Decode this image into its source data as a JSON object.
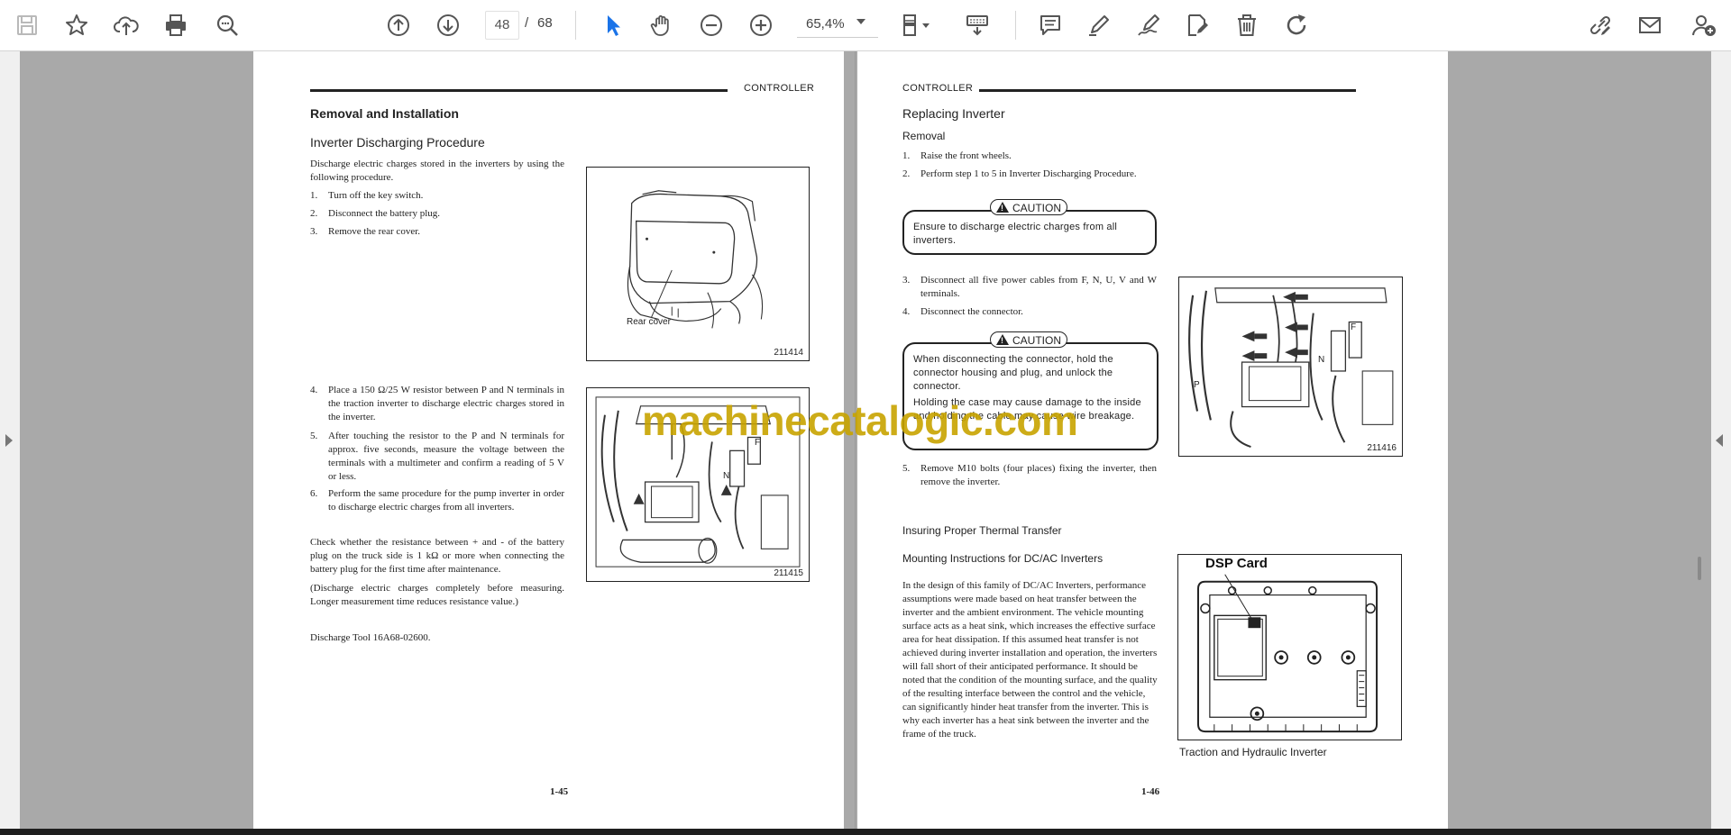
{
  "toolbar": {
    "page_current": "48",
    "page_separator": "/",
    "page_total": "68",
    "zoom_value": "65,4%",
    "icons": [
      "save-icon",
      "bookmark-star-icon",
      "upload-cloud-icon",
      "print-icon",
      "search-zoom-icon",
      "arrow-up-circle-icon",
      "arrow-down-circle-icon",
      "select-cursor-icon",
      "hand-tool-icon",
      "zoom-out-icon",
      "zoom-in-icon",
      "page-display-icon",
      "keyboard-scroll-icon",
      "comment-icon",
      "highlight-pen-icon",
      "draw-pen-icon",
      "edit-pdf-icon",
      "trash-icon",
      "rotate-icon",
      "share-link-icon",
      "email-icon",
      "add-user-icon"
    ]
  },
  "left_page": {
    "header": "CONTROLLER",
    "section_title": "Removal and Installation",
    "subsection_title": "Inverter Discharging Procedure",
    "intro": "Discharge electric charges stored in the inverters by using the following procedure.",
    "steps_a": [
      {
        "n": "1.",
        "text": "Turn off the key switch."
      },
      {
        "n": "2.",
        "text": "Disconnect the battery plug."
      },
      {
        "n": "3.",
        "text": "Remove the rear cover."
      }
    ],
    "fig1": {
      "label": "Rear cover",
      "number": "211414"
    },
    "steps_b": [
      {
        "n": "4.",
        "text": "Place a 150 Ω/25 W resistor between P and N terminals in the traction inverter to discharge electric charges stored in the inverter."
      },
      {
        "n": "5.",
        "text": "After touching the resistor to the P and N terminals for approx. five seconds, measure the voltage between the terminals with a multimeter and confirm a reading of 5 V or less."
      },
      {
        "n": "6.",
        "text": "Perform the same procedure for the pump inverter in order to discharge electric charges from all inverters."
      }
    ],
    "fig2": {
      "number": "211415",
      "label_f": "F",
      "label_n": "N"
    },
    "note1": "Check whether the resistance between + and - of the battery plug on the truck side is 1 kΩ or more when connecting the battery plug for the first time after maintenance.",
    "note2": "(Discharge electric charges completely before measuring. Longer measurement time reduces resistance value.)",
    "tool": "Discharge Tool 16A68-02600.",
    "page_number": "1-45"
  },
  "right_page": {
    "header": "CONTROLLER",
    "section_title": "Replacing Inverter",
    "subsection_title": "Removal",
    "steps_a": [
      {
        "n": "1.",
        "text": "Raise the front wheels."
      },
      {
        "n": "2.",
        "text": "Perform step 1 to 5 in Inverter Discharging Procedure."
      }
    ],
    "caution1": {
      "badge": "CAUTION",
      "text": "Ensure to discharge electric charges from all inverters."
    },
    "steps_b": [
      {
        "n": "3.",
        "text": "Disconnect all five power cables from F, N, U, V and W terminals."
      },
      {
        "n": "4.",
        "text": "Disconnect the connector."
      }
    ],
    "caution2": {
      "badge": "CAUTION",
      "text1": "When disconnecting the connector, hold the connector housing and plug, and unlock the connector.",
      "text2": "Holding the case may cause damage to the inside and holding the cable may cause wire breakage."
    },
    "fig3": {
      "number": "211416",
      "label_f": "F",
      "label_n": "N",
      "label_p": "P"
    },
    "steps_c": [
      {
        "n": "5.",
        "text": "Remove M10 bolts (four places) fixing the inverter, then remove the inverter."
      }
    ],
    "heading_thermal": "Insuring Proper Thermal Transfer",
    "heading_mounting": "Mounting Instructions for DC/AC Inverters",
    "mounting_text": "In the design of this family of DC/AC Inverters, performance assumptions were made based on heat transfer between the inverter and the ambient environment. The vehicle mounting surface acts as a heat sink, which increases the effective surface area for heat dissipation. If this assumed heat transfer is not achieved during inverter installation and operation, the inverters will fall short of their anticipated performance. It should be noted that the condition of the mounting surface, and the quality of the resulting interface between the control and the vehicle, can significantly hinder heat transfer from the inverter. This is why each inverter has a heat sink between the inverter and the frame of the truck.",
    "fig4": {
      "title": "DSP Card",
      "caption": "Traction and Hydraulic Inverter"
    },
    "page_number": "1-46"
  },
  "watermark": "machinecatalogic.com",
  "colors": {
    "watermark": "#c8a400",
    "accent_blue": "#1a73e8",
    "viewer_bg": "#a9a9a9"
  }
}
